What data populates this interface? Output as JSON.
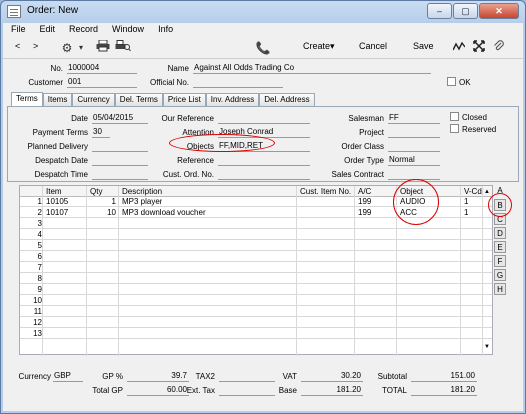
{
  "window": {
    "title": "Order: New",
    "min_glyph": "–",
    "max_glyph": "▢",
    "close_glyph": "✕"
  },
  "menu": [
    "File",
    "Edit",
    "Record",
    "Window",
    "Info"
  ],
  "toolbar": {
    "back": "<",
    "fwd": ">",
    "create": "Create▾",
    "cancel": "Cancel",
    "save": "Save"
  },
  "header": {
    "no_label": "No.",
    "no_value": "1000004",
    "name_label": "Name",
    "name_value": "Against All Odds Trading Co",
    "customer_label": "Customer",
    "customer_value": "001",
    "official_label": "Official No.",
    "official_value": "",
    "ok_label": "OK"
  },
  "tabs": [
    "Terms",
    "Items",
    "Currency",
    "Del. Terms",
    "Price List",
    "Inv. Address",
    "Del. Address"
  ],
  "terms": {
    "date_label": "Date",
    "date_value": "05/04/2015",
    "payterms_label": "Payment Terms",
    "payterms_value": "30",
    "planned_label": "Planned Delivery",
    "planned_value": "",
    "despdate_label": "Despatch Date",
    "despdate_value": "",
    "desptime_label": "Despatch Time",
    "desptime_value": "",
    "ourref_label": "Our Reference",
    "ourref_value": "",
    "attention_label": "Attention",
    "attention_value": "Joseph Conrad",
    "objects_label": "Objects",
    "objects_value": "FF,MID,RET",
    "reference_label": "Reference",
    "reference_value": "",
    "custord_label": "Cust. Ord. No.",
    "custord_value": "",
    "salesman_label": "Salesman",
    "salesman_value": "FF",
    "project_label": "Project",
    "project_value": "",
    "orderclass_label": "Order Class",
    "orderclass_value": "",
    "ordertype_label": "Order Type",
    "ordertype_value": "Normal",
    "salescontract_label": "Sales Contract",
    "salescontract_value": "",
    "closed_label": "Closed",
    "reserved_label": "Reserved"
  },
  "grid": {
    "headers": {
      "item": "Item",
      "qty": "Qty",
      "desc": "Description",
      "custitem": "Cust. Item No.",
      "ac": "A/C",
      "object": "Object",
      "vcd": "V-Cd"
    },
    "rows": [
      {
        "n": "1",
        "item": "10105",
        "qty": "1",
        "desc": "MP3 player",
        "custitem": "",
        "ac": "199",
        "object": "AUDIO",
        "vcd": "1"
      },
      {
        "n": "2",
        "item": "10107",
        "qty": "10",
        "desc": "MP3 download voucher",
        "custitem": "",
        "ac": "199",
        "object": "ACC",
        "vcd": "1"
      },
      {
        "n": "3"
      },
      {
        "n": "4"
      },
      {
        "n": "5"
      },
      {
        "n": "6"
      },
      {
        "n": "7"
      },
      {
        "n": "8"
      },
      {
        "n": "9"
      },
      {
        "n": "10"
      },
      {
        "n": "11"
      },
      {
        "n": "12"
      },
      {
        "n": "13"
      }
    ],
    "side_tabs": [
      "A",
      "B",
      "C",
      "D",
      "E",
      "F",
      "G",
      "H"
    ]
  },
  "footer": {
    "currency_label": "Currency",
    "currency_value": "GBP",
    "gp_label": "GP %",
    "gp_value": "39.7",
    "totalgp_label": "Total GP",
    "totalgp_value": "60.00",
    "tax2_label": "TAX2",
    "tax2_value": "",
    "exttax_label": "Ext. Tax",
    "exttax_value": "",
    "vat_label": "VAT",
    "vat_value": "30.20",
    "base_label": "Base",
    "base_value": "181.20",
    "subtotal_label": "Subtotal",
    "subtotal_value": "151.00",
    "total_label": "TOTAL",
    "total_value": "181.20"
  },
  "colors": {
    "annotation_ring": "#e00000",
    "title_bar": "#b5cde9"
  }
}
